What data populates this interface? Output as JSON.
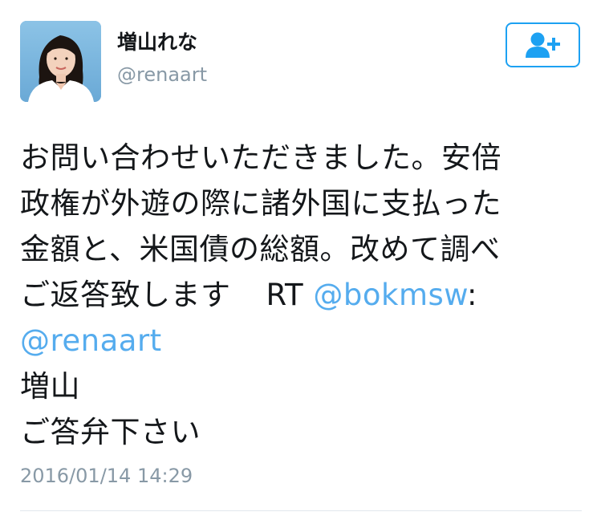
{
  "user": {
    "display_name": "増山れな",
    "handle": "@renaart"
  },
  "follow_button": {
    "icon": "add-user-icon",
    "color": "#1da1f2"
  },
  "tweet": {
    "line1": "お問い合わせいただきました。安倍",
    "line2": "政権が外遊の際に諸外国に支払った",
    "line3": "金額と、米国債の総額。改めて調べ",
    "line4_text": "ご返答致します",
    "rt_label": "RT",
    "rt_mention": "@bokmsw",
    "rt_colon": ":",
    "line5_mention": "@renaart",
    "line6": "増山",
    "line7": "ご答弁下さい"
  },
  "timestamp": "2016/01/14 14:29",
  "colors": {
    "link": "#55acee",
    "muted": "#8899a6",
    "text": "#14171a"
  }
}
